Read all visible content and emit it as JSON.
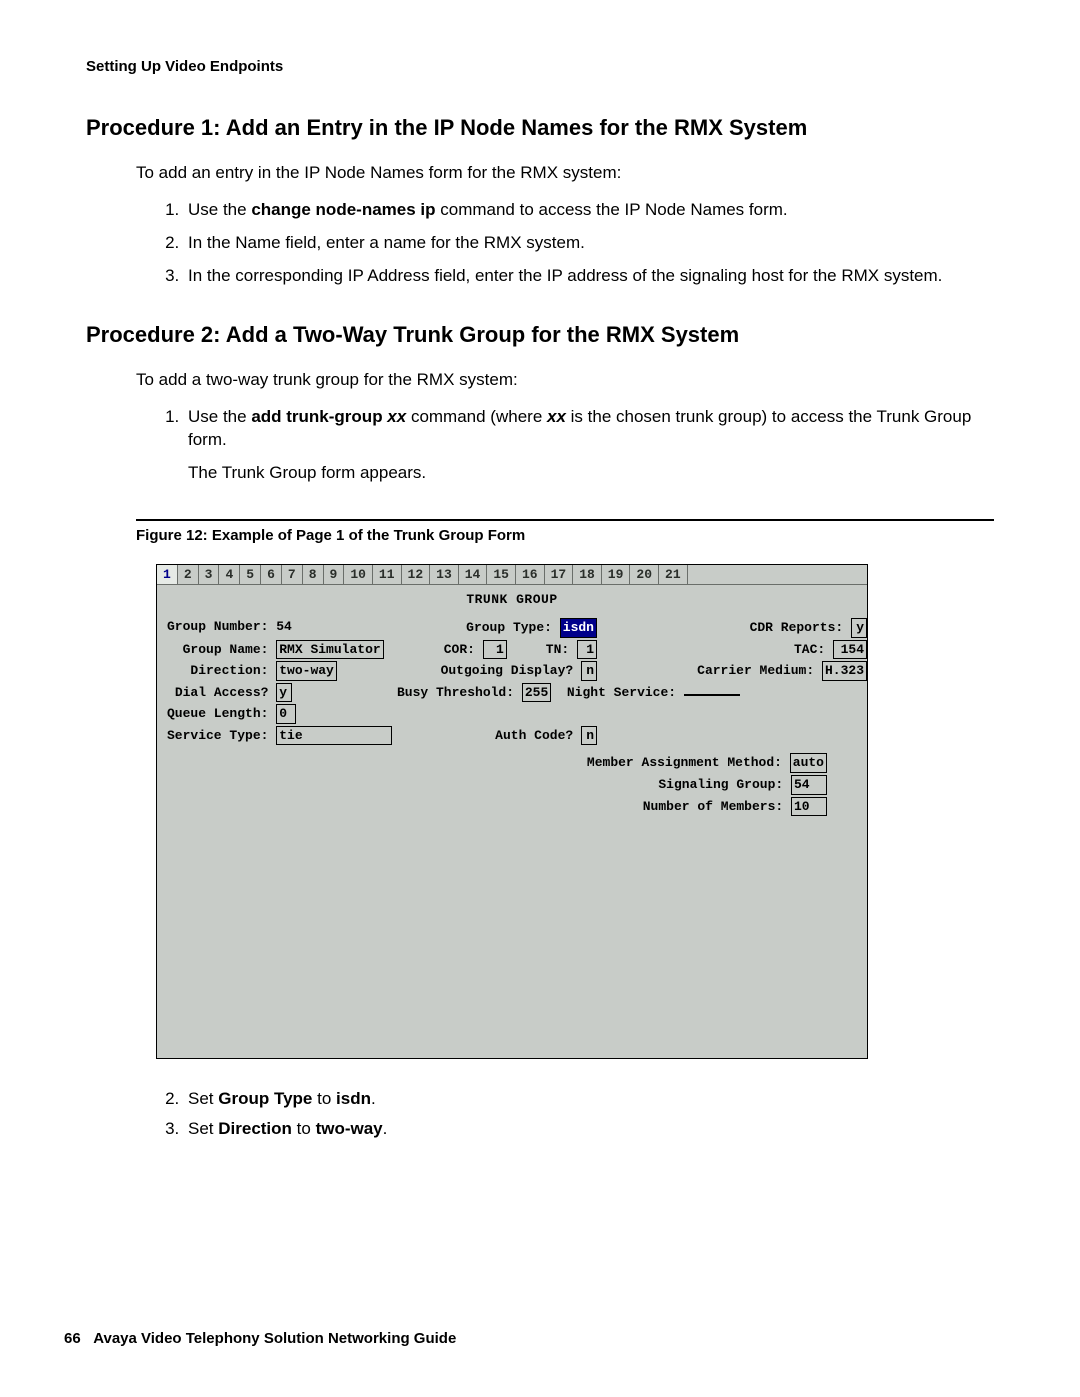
{
  "header": {
    "section": "Setting Up Video Endpoints"
  },
  "proc1": {
    "title": "Procedure 1: Add an Entry in the IP Node Names for the RMX System",
    "intro": "To add an entry in the IP Node Names form for the RMX system:",
    "steps": {
      "s1a": "Use the ",
      "s1b": "change node-names ip",
      "s1c": " command to access the IP Node Names form.",
      "s2": "In the Name field, enter a name for the RMX system.",
      "s3": "In the corresponding IP Address field, enter the IP address of the signaling host for the RMX system."
    }
  },
  "proc2": {
    "title": "Procedure 2: Add a Two-Way Trunk Group for the RMX System",
    "intro": "To add a two-way trunk group for the RMX system:",
    "steps": {
      "s1a": "Use the ",
      "s1b": "add trunk-group ",
      "s1c": "xx",
      "s1d": " command (where ",
      "s1e": "xx",
      "s1f": " is the chosen trunk group) to access the Trunk Group form.",
      "s1g": "The Trunk Group form appears."
    },
    "steps2": {
      "s2a": "Set ",
      "s2b": "Group Type",
      "s2c": " to ",
      "s2d": "isdn",
      "s2e": ".",
      "s3a": "Set ",
      "s3b": "Direction",
      "s3c": " to ",
      "s3d": "two-way",
      "s3e": "."
    }
  },
  "figure": {
    "caption": "Figure 12: Example of Page 1 of the Trunk Group Form",
    "tabs": [
      "1",
      "2",
      "3",
      "4",
      "5",
      "6",
      "7",
      "8",
      "9",
      "10",
      "11",
      "12",
      "13",
      "14",
      "15",
      "16",
      "17",
      "18",
      "19",
      "20",
      "21"
    ],
    "title": "TRUNK GROUP",
    "form": {
      "group_number_lbl": "Group Number:",
      "group_number": "54",
      "group_type_lbl": "Group Type:",
      "group_type": "isdn",
      "cdr_reports_lbl": "CDR Reports:",
      "cdr_reports": "y",
      "group_name_lbl": "Group Name:",
      "group_name": "RMX Simulator",
      "cor_lbl": "COR:",
      "cor": "1",
      "tn_lbl": "TN:",
      "tn": "1",
      "tac_lbl": "TAC:",
      "tac": "154",
      "direction_lbl": "Direction:",
      "direction": "two-way",
      "outgoing_display_lbl": "Outgoing Display?",
      "outgoing_display": "n",
      "carrier_medium_lbl": "Carrier Medium:",
      "carrier_medium": "H.323",
      "dial_access_lbl": "Dial Access?",
      "dial_access": "y",
      "busy_threshold_lbl": "Busy Threshold:",
      "busy_threshold": "255",
      "night_service_lbl": "Night Service:",
      "night_service": "",
      "queue_length_lbl": "Queue Length:",
      "queue_length": "0",
      "service_type_lbl": "Service Type:",
      "service_type": "tie",
      "auth_code_lbl": "Auth Code?",
      "auth_code": "n",
      "mam_lbl": "Member Assignment Method:",
      "mam": "auto",
      "sig_group_lbl": "Signaling Group:",
      "sig_group": "54",
      "num_members_lbl": "Number of Members:",
      "num_members": "10"
    }
  },
  "footer": {
    "page": "66",
    "title": "Avaya Video Telephony Solution Networking Guide"
  }
}
